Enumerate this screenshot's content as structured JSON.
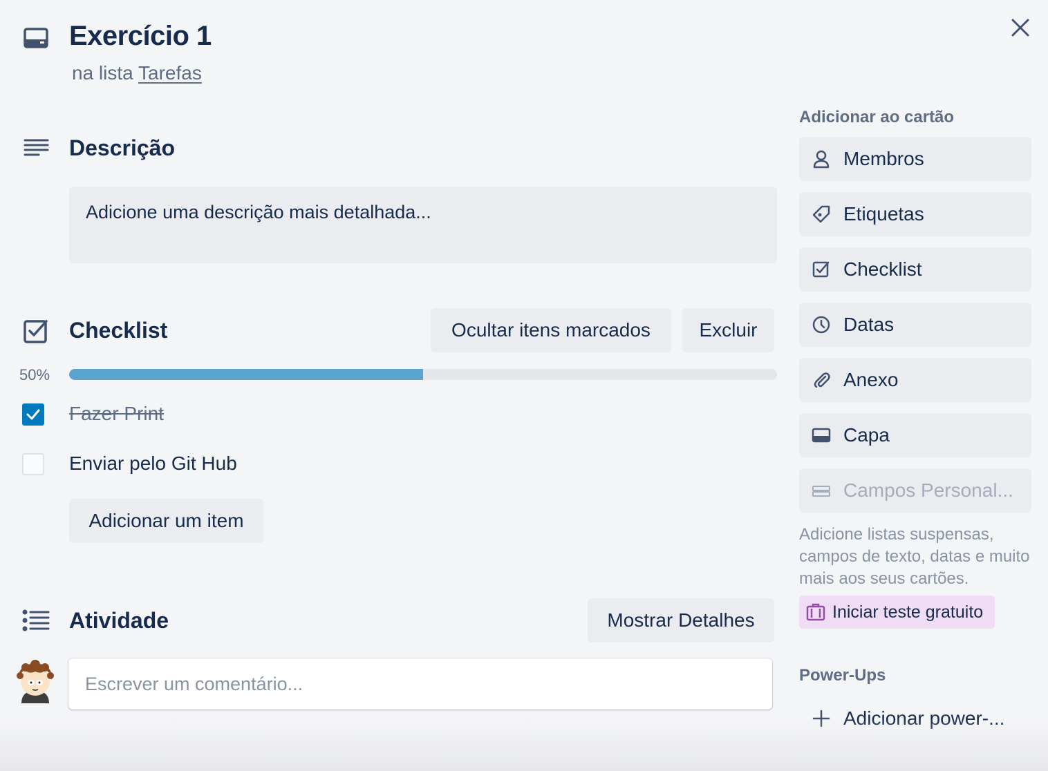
{
  "card": {
    "title": "Exercício 1",
    "list_prefix": "na lista",
    "list_name": "Tarefas"
  },
  "description": {
    "heading": "Descrição",
    "placeholder": "Adicione uma descrição mais detalhada..."
  },
  "checklist": {
    "heading": "Checklist",
    "hide_checked_label": "Ocultar itens marcados",
    "delete_label": "Excluir",
    "progress_label": "50%",
    "progress_fraction": 0.5,
    "items": [
      {
        "label": "Fazer Print",
        "checked": true
      },
      {
        "label": "Enviar pelo Git Hub",
        "checked": false
      }
    ],
    "add_item_label": "Adicionar um item"
  },
  "activity": {
    "heading": "Atividade",
    "show_details_label": "Mostrar Detalhes",
    "comment_placeholder": "Escrever um comentário..."
  },
  "sidebar": {
    "add_to_card_heading": "Adicionar ao cartão",
    "buttons": [
      {
        "label": "Membros",
        "icon": "person-icon"
      },
      {
        "label": "Etiquetas",
        "icon": "tag-icon"
      },
      {
        "label": "Checklist",
        "icon": "checklist-icon"
      },
      {
        "label": "Datas",
        "icon": "clock-icon"
      },
      {
        "label": "Anexo",
        "icon": "paperclip-icon"
      },
      {
        "label": "Capa",
        "icon": "cover-icon"
      },
      {
        "label": "Campos Personal...",
        "icon": "custom-fields-icon",
        "disabled": true
      }
    ],
    "custom_fields_help": "Adicione listas suspensas, campos de texto, datas e muito mais aos seus cartões.",
    "trial_label": "Iniciar teste gratuito",
    "powerups_heading": "Power-Ups",
    "add_powerup_label": "Adicionar power-..."
  },
  "colors": {
    "background": "#f4f5f7",
    "text": "#172b4d",
    "muted": "#5e6c84",
    "button_bg": "#ebecf0",
    "progress_fill": "#5ba4cf",
    "checkbox_checked": "#0079bf",
    "trial_bg": "#f0dcf5",
    "trial_icon": "#8f4fa3"
  }
}
